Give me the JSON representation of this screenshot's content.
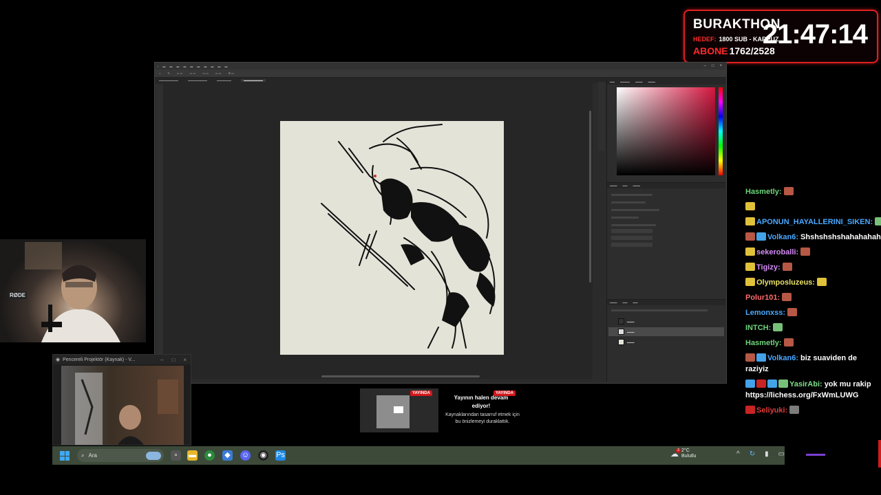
{
  "overlay": {
    "title": "BURAKTHON",
    "goal_label": "HEDEF:",
    "goal_value": "1800 SUB - KARPUZ",
    "subs_label": "ABONE",
    "subs_value": "1762/2528",
    "timer": "21:47:14",
    "accent_color": "#e02020"
  },
  "projector": {
    "title": "Pencereli Projektör (Kaynak) - V..."
  },
  "notification": {
    "badge_1": "YAYINDA",
    "badge_2": "YAYINDA",
    "title": "Yayının halen devam ediyor!",
    "body": "Kaynaklarından tasarruf etmek için bu önizlemeyi duraklattık."
  },
  "taskbar": {
    "search_placeholder": "Ara",
    "weather_temp": "2°C",
    "weather_desc": "Bulutlu",
    "weather_badge": "3"
  },
  "webcam": {
    "mic_brand": "RØDE"
  },
  "chat": {
    "messages": [
      {
        "user": "Hasmetly:",
        "color": "#6fd47a",
        "text": ""
      },
      {
        "user": "",
        "color": "#ffffff",
        "text": ""
      },
      {
        "user": "APONUN_HAYALLERINI_SIKEN:",
        "color": "#4aa8ff",
        "text": ""
      },
      {
        "user": "Volkan6:",
        "color": "#4aa8ff",
        "text": "Shshshshshahahahahah"
      },
      {
        "user": "sekeroballi:",
        "color": "#d58cf7",
        "text": ""
      },
      {
        "user": "Tigizy:",
        "color": "#d58cf7",
        "text": ""
      },
      {
        "user": "Olymposluzeus:",
        "color": "#e8e06a",
        "text": ""
      },
      {
        "user": "Polur101:",
        "color": "#ff6b6b",
        "text": ""
      },
      {
        "user": "Lemonxss:",
        "color": "#4aa8ff",
        "text": ""
      },
      {
        "user": "INTCH:",
        "color": "#6fd47a",
        "text": ""
      },
      {
        "user": "Hasmetly:",
        "color": "#6fd47a",
        "text": ""
      },
      {
        "user": "Volkan6:",
        "color": "#4aa8ff",
        "text": "biz suaviden de raziyiz"
      },
      {
        "user": "YasirAbi:",
        "color": "#7ce08a",
        "text": "yok mu rakip https://lichess.org/FxWmLUWG"
      },
      {
        "user": "Seliyuki:",
        "color": "#e03b3b",
        "text": ""
      }
    ]
  }
}
